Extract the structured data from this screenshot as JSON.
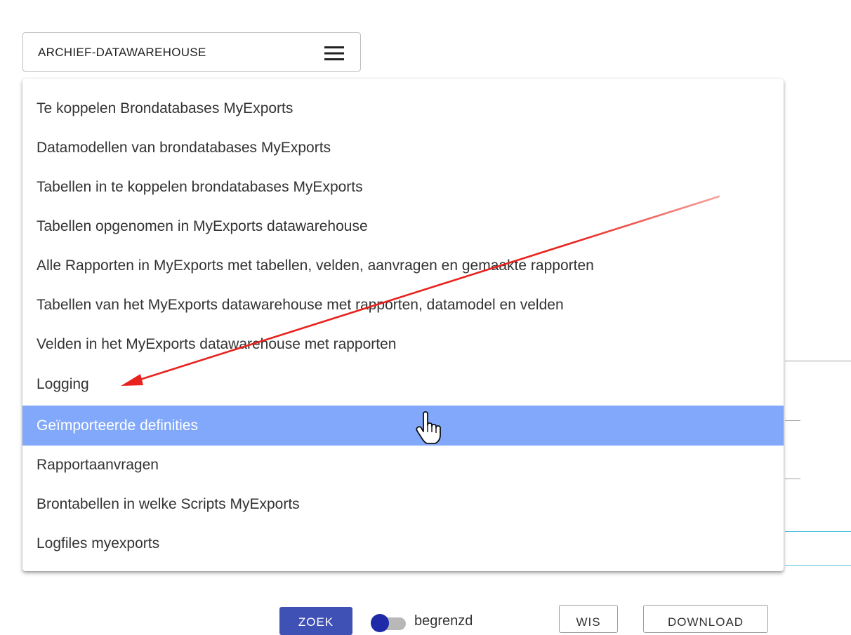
{
  "menu": {
    "trigger_label": "ARCHIEF-DATAWAREHOUSE",
    "trigger_icon": "hamburger-icon",
    "items": [
      {
        "label": "Te koppelen Brondatabases MyExports"
      },
      {
        "label": "Datamodellen van brondatabases MyExports"
      },
      {
        "label": "Tabellen in te koppelen brondatabases MyExports"
      },
      {
        "label": "Tabellen opgenomen in MyExports datawarehouse"
      },
      {
        "label": "Alle Rapporten in MyExports met tabellen, velden, aanvragen en gemaakte rapporten"
      },
      {
        "label": "Tabellen van het MyExports datawarehouse met rapporten, datamodel en velden"
      },
      {
        "label": "Velden in het MyExports datawarehouse met rapporten"
      },
      {
        "label": "Logging"
      },
      {
        "label": "Geïmporteerde definities",
        "selected": true
      },
      {
        "label": "Rapportaanvragen"
      },
      {
        "label": "Brontabellen in welke Scripts MyExports"
      },
      {
        "label": "Logfiles myexports"
      }
    ],
    "selected_color": "#82a8fc"
  },
  "actions": {
    "zoek_label": "ZOEK",
    "toggle_label": "begrenzd",
    "wis_label": "WIS",
    "download_label": "DOWNLOAD",
    "primary_color": "#3f51b5"
  },
  "annotation": {
    "arrow_color": "#e8231e",
    "arrow_icon": "red-arrow-annotation",
    "cursor_icon": "hand-pointer-icon"
  }
}
